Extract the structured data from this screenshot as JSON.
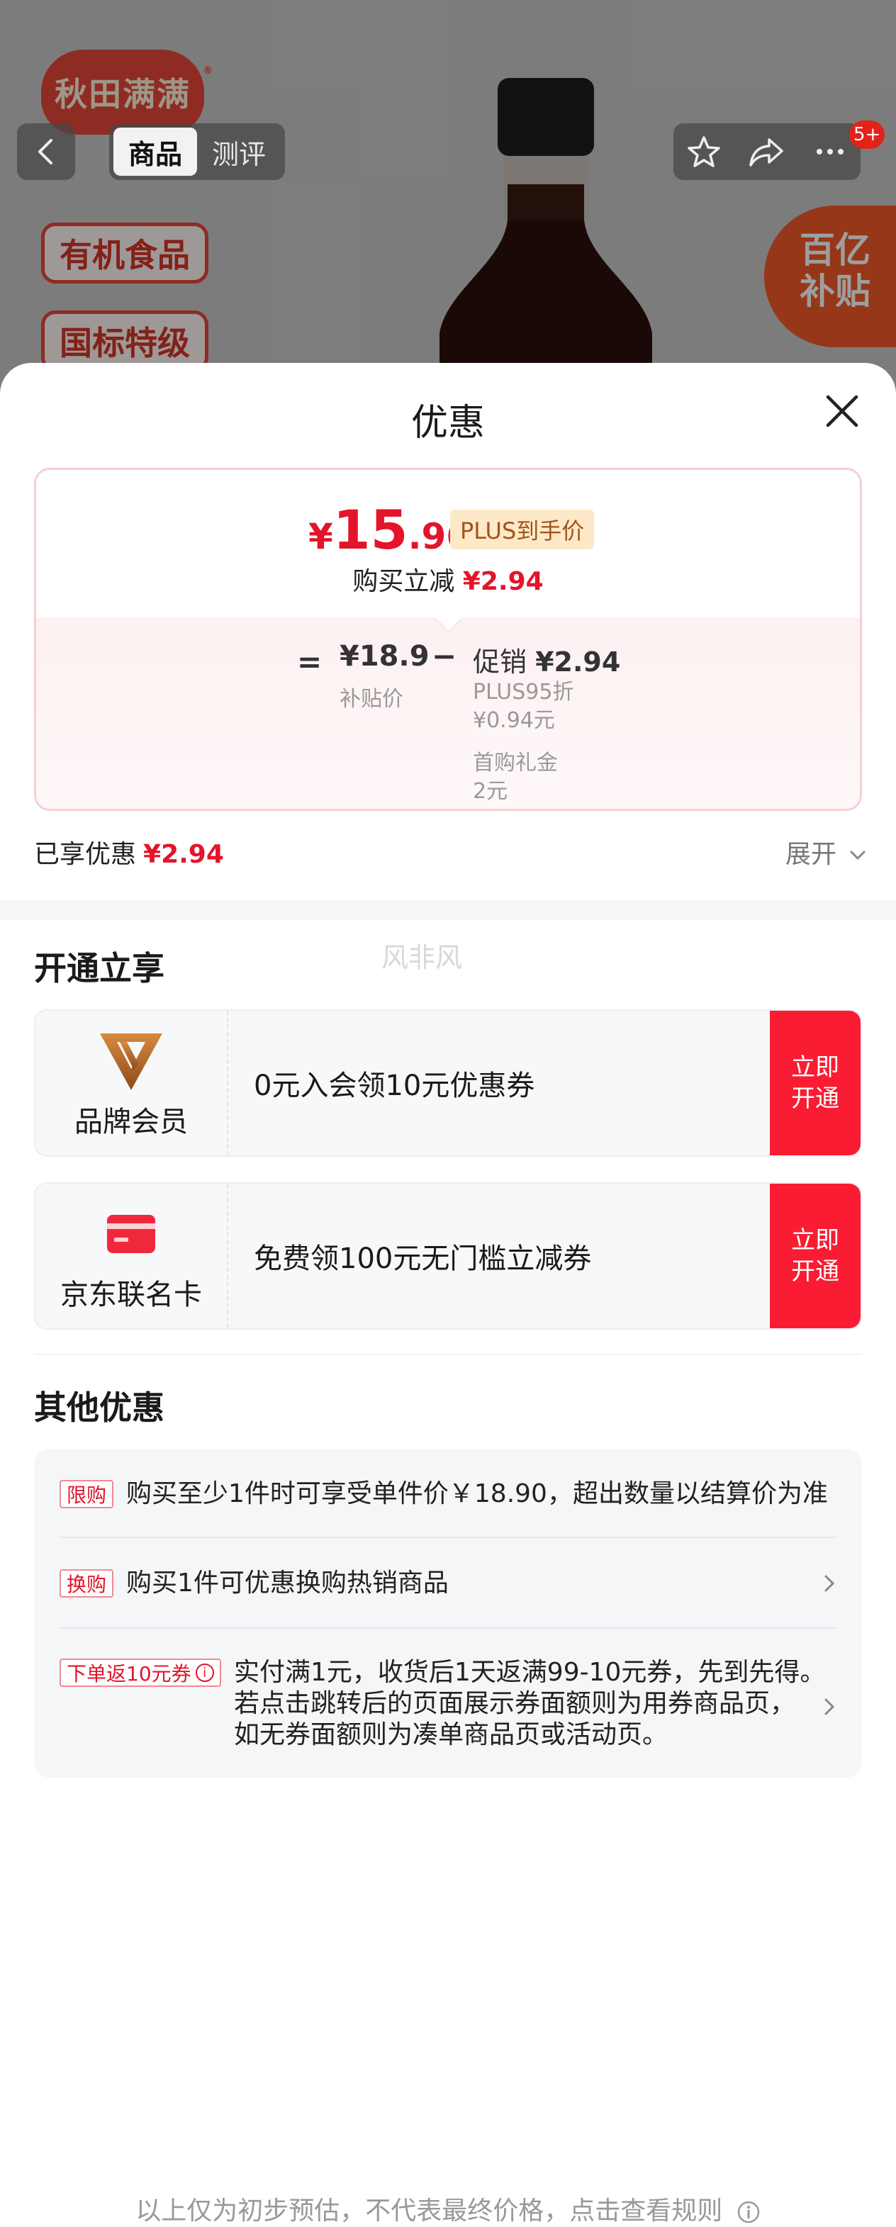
{
  "backdrop": {
    "brand_logo": "秋田满满",
    "tags": [
      "有机食品",
      "国标特级"
    ],
    "subsidy_badge": [
      "百亿",
      "补贴"
    ]
  },
  "nav": {
    "tabs": [
      "商品",
      "测评"
    ],
    "active_tab": "商品",
    "badge_count": "5+",
    "icons": [
      "back-icon",
      "star-icon",
      "share-icon",
      "more-icon"
    ]
  },
  "sheet": {
    "title": "优惠",
    "price_card": {
      "currency": "¥",
      "price_int": "15",
      "price_dec": ".96",
      "plus_tag": "PLUS到手价",
      "reduce_label": "购买立减",
      "reduce_value": "¥2.94",
      "eq": "=",
      "base_price": "¥18.9",
      "base_label": "补贴价",
      "minus": "−",
      "promo_label": "促销",
      "promo_value": "¥2.94",
      "promo_items": [
        {
          "name": "PLUS95折",
          "value": "¥0.94元"
        },
        {
          "name": "首购礼金",
          "value": "2元"
        }
      ]
    },
    "enjoyed_label": "已享优惠",
    "enjoyed_value": "¥2.94",
    "expand_label": "展开",
    "watermark": "风非风",
    "membership": {
      "title": "开通立享",
      "rows": [
        {
          "name": "品牌会员",
          "desc": "0元入会领10元优惠券",
          "button": "立即\n开通",
          "icon": "brand-v-icon"
        },
        {
          "name": "京东联名卡",
          "desc": "免费领100元无门槛立减券",
          "button": "立即\n开通",
          "icon": "card-icon"
        }
      ]
    },
    "other": {
      "title": "其他优惠",
      "offers": [
        {
          "tag": "限购",
          "text": "购买至少1件时可享受单件价￥18.90，超出数量以结算价为准"
        },
        {
          "tag": "换购",
          "text": "购买1件可优惠换购热销商品"
        },
        {
          "tag": "下单返10元券",
          "lines": [
            "实付满1元，收货后1天返满99-10元券，先到先得。",
            "若点击跳转后的页面展示券面额则为用券商品页，",
            "如无券面额则为凑单商品页或活动页。"
          ]
        }
      ]
    },
    "footer_note": "以上仅为初步预估，不代表最终价格，点击查看规则"
  },
  "colors": {
    "accent_red": "#fa1c32",
    "price_red": "#e3142b",
    "plus_gold": "#a3541a"
  }
}
